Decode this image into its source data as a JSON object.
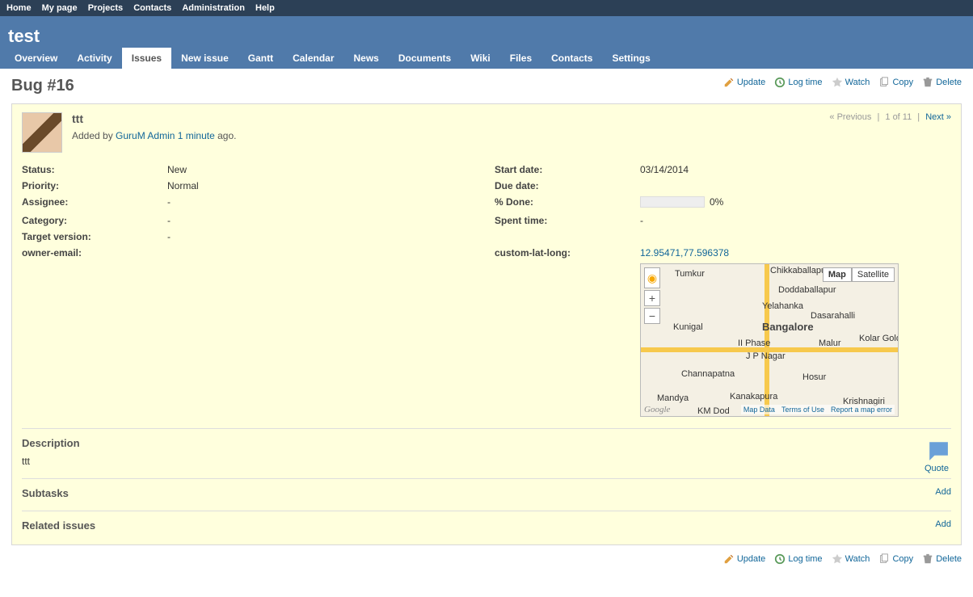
{
  "top_menu": {
    "items": [
      "Home",
      "My page",
      "Projects",
      "Contacts",
      "Administration",
      "Help"
    ]
  },
  "project_title": "test",
  "main_menu": {
    "items": [
      "Overview",
      "Activity",
      "Issues",
      "New issue",
      "Gantt",
      "Calendar",
      "News",
      "Documents",
      "Wiki",
      "Files",
      "Contacts",
      "Settings"
    ],
    "selected": "Issues"
  },
  "page_title": "Bug #16",
  "actions": {
    "update": "Update",
    "log_time": "Log time",
    "watch": "Watch",
    "copy": "Copy",
    "delete": "Delete"
  },
  "issue": {
    "subject": "ttt",
    "added_by_prefix": "Added by ",
    "author": "GuruM Admin",
    "age": "1 minute",
    "added_by_suffix": " ago.",
    "nav": {
      "prev": "« Previous",
      "position": "1 of 11",
      "next": "Next »"
    }
  },
  "attrs": {
    "status": {
      "label": "Status:",
      "value": "New"
    },
    "priority": {
      "label": "Priority:",
      "value": "Normal"
    },
    "assignee": {
      "label": "Assignee:",
      "value": "-"
    },
    "category": {
      "label": "Category:",
      "value": "-"
    },
    "target_version": {
      "label": "Target version:",
      "value": "-"
    },
    "owner_email": {
      "label": "owner-email:",
      "value": ""
    },
    "start_date": {
      "label": "Start date:",
      "value": "03/14/2014"
    },
    "due_date": {
      "label": "Due date:",
      "value": ""
    },
    "done": {
      "label": "% Done:",
      "pct": "0%"
    },
    "spent_time": {
      "label": "Spent time:",
      "value": "-"
    },
    "custom_latlong": {
      "label": "custom-lat-long:",
      "value": "12.95471,77.596378"
    }
  },
  "map": {
    "type_map": "Map",
    "type_sat": "Satellite",
    "cities": {
      "tumkur": "Tumkur",
      "chikkaballapur": "Chikkaballapur",
      "doddaballapur": "Doddaballapur",
      "yelahanka": "Yelahanka",
      "dasarahalli": "Dasarahalli",
      "kunigal": "Kunigal",
      "bangalore": "Bangalore",
      "iiphase": "II Phase",
      "malur": "Malur",
      "kolar": "Kolar Gold Fields",
      "jpnagar": "J P Nagar",
      "channapatna": "Channapatna",
      "hosur": "Hosur",
      "mandya": "Mandya",
      "kanakapura": "Kanakapura",
      "krishnagiri": "Krishnagiri",
      "kmdod": "KM Dod"
    },
    "footer": {
      "data": "Map Data",
      "terms": "Terms of Use",
      "report": "Report a map error",
      "google": "Google"
    }
  },
  "description": {
    "heading": "Description",
    "text": "ttt",
    "quote": "Quote"
  },
  "subtasks": {
    "heading": "Subtasks",
    "add": "Add"
  },
  "related": {
    "heading": "Related issues",
    "add": "Add"
  }
}
